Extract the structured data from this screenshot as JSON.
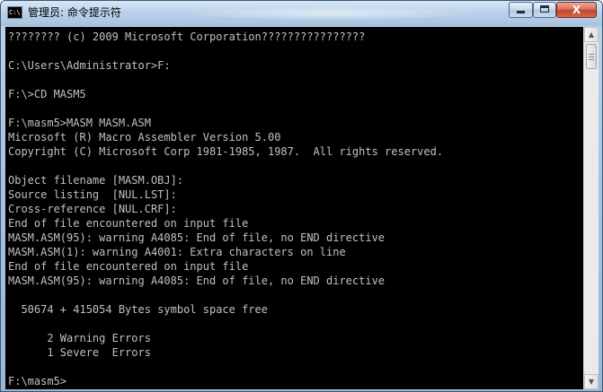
{
  "window": {
    "title": "管理员: 命令提示符",
    "app_icon_text": "C:\\.",
    "controls": {
      "minimize": "minimize",
      "maximize": "maximize",
      "close": "X"
    }
  },
  "console": {
    "background": "#000000",
    "foreground": "#c0c0c0",
    "lines": [
      "???????? (c) 2009 Microsoft Corporation????????????????",
      "",
      "C:\\Users\\Administrator>F:",
      "",
      "F:\\>CD MASM5",
      "",
      "F:\\masm5>MASM MASM.ASM",
      "Microsoft (R) Macro Assembler Version 5.00",
      "Copyright (C) Microsoft Corp 1981-1985, 1987.  All rights reserved.",
      "",
      "Object filename [MASM.OBJ]:",
      "Source listing  [NUL.LST]:",
      "Cross-reference [NUL.CRF]:",
      "End of file encountered on input file",
      "MASM.ASM(95): warning A4085: End of file, no END directive",
      "MASM.ASM(1): warning A4001: Extra characters on line",
      "End of file encountered on input file",
      "MASM.ASM(95): warning A4085: End of file, no END directive",
      "",
      "  50674 + 415054 Bytes symbol space free",
      "",
      "      2 Warning Errors",
      "      1 Severe  Errors",
      "",
      "F:\\masm5>"
    ]
  },
  "scrollbar": {
    "up_arrow": "▲",
    "down_arrow": "▼",
    "position": 0.0
  }
}
